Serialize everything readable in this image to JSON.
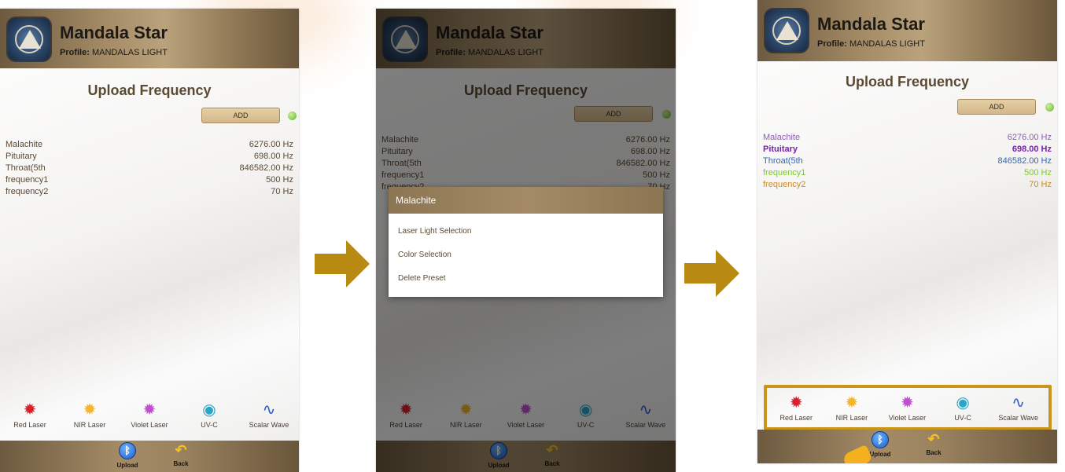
{
  "app": {
    "title": "Mandala Star",
    "profile_label": "Profile:",
    "profile_name": "MANDALAS LIGHT",
    "page_title": "Upload Frequency",
    "add_label": "ADD"
  },
  "frequencies": [
    {
      "name": "Malachite",
      "value": "6276.00 Hz",
      "color": "#8a5fb5"
    },
    {
      "name": "Pituitary",
      "value": "698.00 Hz",
      "color": "#7a1fb0"
    },
    {
      "name": "Throat(5th",
      "value": "846582.00 Hz",
      "color": "#2f67b8"
    },
    {
      "name": "frequency1",
      "value": "500 Hz",
      "color": "#7acd2c"
    },
    {
      "name": "frequency2",
      "value": "70 Hz",
      "color": "#d08a1f"
    }
  ],
  "default_text_color": "#5a4a33",
  "tools": [
    {
      "label": "Red Laser",
      "icon": "red-laser-icon",
      "glyph": "✹",
      "color": "#d8202c"
    },
    {
      "label": "NIR Laser",
      "icon": "nir-laser-icon",
      "glyph": "✹",
      "color": "#f3b52a"
    },
    {
      "label": "Violet Laser",
      "icon": "violet-laser-icon",
      "glyph": "✹",
      "color": "#c04fd0"
    },
    {
      "label": "UV-C",
      "icon": "uvc-icon",
      "glyph": "◉",
      "color": "#2aa6c8"
    },
    {
      "label": "Scalar Wave",
      "icon": "scalar-wave-icon",
      "glyph": "∿",
      "color": "#2f58c8"
    }
  ],
  "footer": {
    "upload_label": "Upload",
    "back_label": "Back",
    "upload_icon": "bluetooth-icon",
    "back_icon": "back-arrow-icon"
  },
  "dialog": {
    "title": "Malachite",
    "items": [
      "Laser Light Selection",
      "Color Selection",
      "Delete Preset"
    ]
  },
  "colors": {
    "accent_gold": "#b98a12",
    "header_brown": "#a48b66",
    "indicator_green": "#69b52f"
  }
}
